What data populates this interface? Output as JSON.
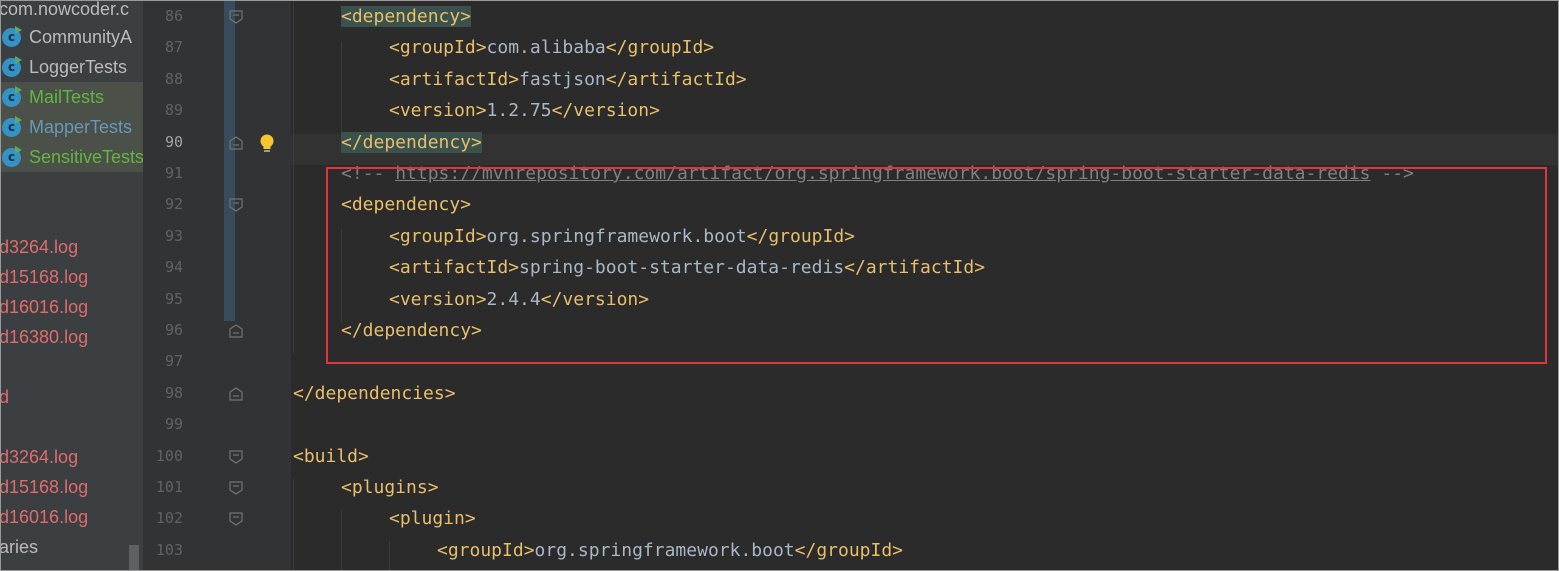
{
  "sidebar": {
    "items": [
      {
        "label": "com.nowcoder.c",
        "color": "#bbbbbb",
        "icon": "none"
      },
      {
        "label": "CommunityA",
        "color": "#bbbbbb",
        "icon": "java-class-test-icon"
      },
      {
        "label": "LoggerTests",
        "color": "#bbbbbb",
        "icon": "java-class-test-icon"
      },
      {
        "label": "MailTests",
        "color": "#62b543",
        "icon": "java-class-test-icon"
      },
      {
        "label": "MapperTests",
        "color": "#6897bb",
        "icon": "java-class-test-icon"
      },
      {
        "label": "SensitiveTests",
        "color": "#62b543",
        "icon": "java-class-test-icon"
      }
    ],
    "files": [
      {
        "label": "d3264.log"
      },
      {
        "label": "d15168.log"
      },
      {
        "label": "d16016.log"
      },
      {
        "label": "d16380.log"
      },
      {
        "label": "d"
      },
      {
        "label": "d3264.log"
      },
      {
        "label": "d15168.log"
      },
      {
        "label": "d16016.log"
      },
      {
        "label": "aries"
      }
    ]
  },
  "editor": {
    "current_line": 90,
    "lines": [
      {
        "num": "86",
        "parts": [
          "<dependency>"
        ]
      },
      {
        "num": "87",
        "parts": [
          "<groupId>",
          "com.alibaba",
          "</groupId>"
        ]
      },
      {
        "num": "88",
        "parts": [
          "<artifactId>",
          "fastjson",
          "</artifactId>"
        ]
      },
      {
        "num": "89",
        "parts": [
          "<version>",
          "1.2.75",
          "</version>"
        ]
      },
      {
        "num": "90",
        "parts": [
          "</dependency>"
        ]
      },
      {
        "num": "91",
        "parts": [
          "<!-- ",
          "https://mvnrepository.com/artifact/org.springframework.boot/spring-boot-starter-data-redis",
          " -->"
        ]
      },
      {
        "num": "92",
        "parts": [
          "<dependency>"
        ]
      },
      {
        "num": "93",
        "parts": [
          "<groupId>",
          "org.springframework.boot",
          "</groupId>"
        ]
      },
      {
        "num": "94",
        "parts": [
          "<artifactId>",
          "spring-boot-starter-data-redis",
          "</artifactId>"
        ]
      },
      {
        "num": "95",
        "parts": [
          "<version>",
          "2.4.4",
          "</version>"
        ]
      },
      {
        "num": "96",
        "parts": [
          "</dependency>"
        ]
      },
      {
        "num": "97",
        "parts": []
      },
      {
        "num": "98",
        "parts": [
          "</dependencies>"
        ]
      },
      {
        "num": "99",
        "parts": []
      },
      {
        "num": "100",
        "parts": [
          "<build>"
        ]
      },
      {
        "num": "101",
        "parts": [
          "<plugins>"
        ]
      },
      {
        "num": "102",
        "parts": [
          "<plugin>"
        ]
      },
      {
        "num": "103",
        "parts": [
          "<groupId>",
          "org.springframework.boot",
          "</groupId>"
        ]
      }
    ]
  },
  "colors": {
    "tag": "#e8bf6a",
    "text": "#a9b7c6",
    "comment": "#808080",
    "highlight_box": "#e0363a",
    "background": "#2b2b2b"
  }
}
